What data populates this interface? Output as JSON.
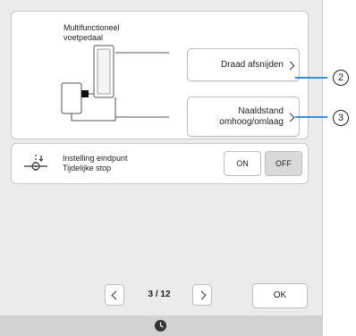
{
  "panel": {
    "title": "Multifunctioneel\nvoetpedaal",
    "thread_cut_label": "Draad afsnijden",
    "needle_pos_label": "Naaldstand\nomhoog/omlaag"
  },
  "end_point": {
    "label": "Instelling eindpunt\nTijdelijke stop",
    "on_label": "ON",
    "off_label": "OFF",
    "selected": "OFF"
  },
  "pager": {
    "indicator": "3 / 12"
  },
  "ok_label": "OK",
  "callouts": [
    "2",
    "3"
  ],
  "colors": {
    "callout_line": "#3a8fd8",
    "screen_bg": "#ebebeb",
    "selected_toggle": "#d9d9d9"
  },
  "icons": {
    "pedal": "foot-pedal-diagram",
    "end_point": "end-point-icon",
    "footer": "clock-icon"
  }
}
